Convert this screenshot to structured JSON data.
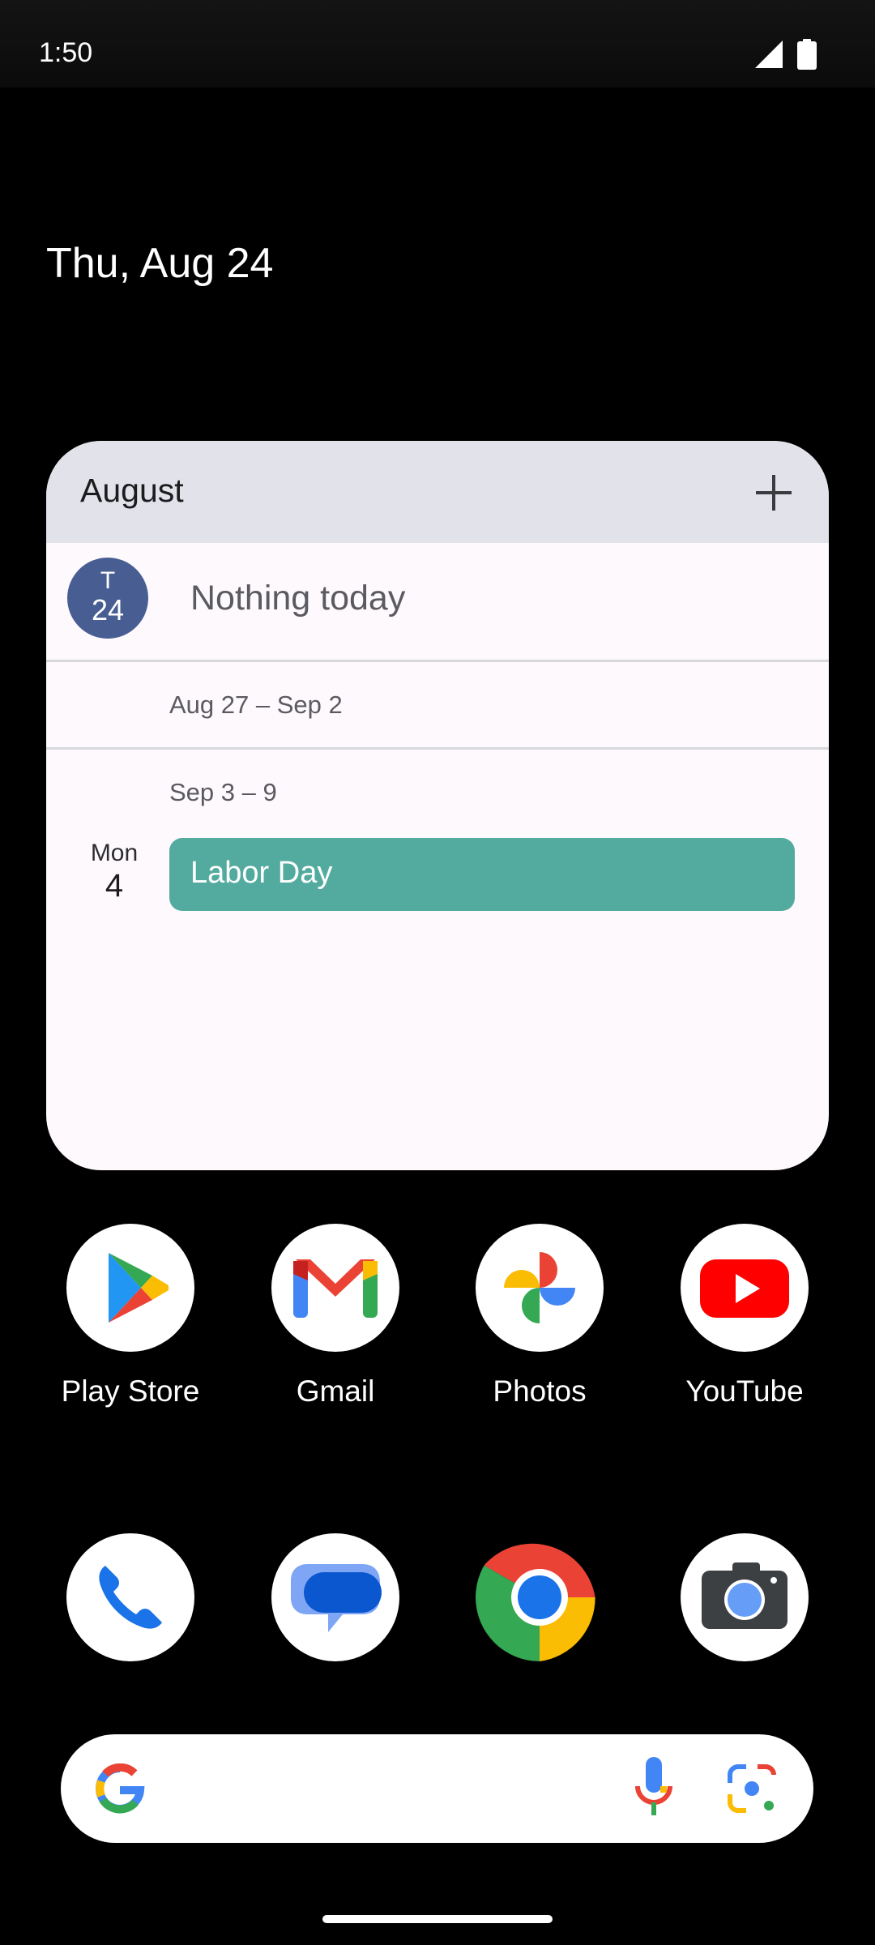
{
  "status_bar": {
    "time": "1:50"
  },
  "home": {
    "date": "Thu, Aug 24"
  },
  "calendar_widget": {
    "month": "August",
    "today": {
      "day_letter": "T",
      "day_number": "24",
      "message": "Nothing today"
    },
    "weeks": [
      {
        "range": "Aug 27 – Sep 2"
      },
      {
        "range": "Sep 3 – 9"
      }
    ],
    "events": [
      {
        "day_of_week": "Mon",
        "day_of_month": "4",
        "title": "Labor Day",
        "color": "#53ab9f"
      }
    ]
  },
  "apps": [
    {
      "label": "Play Store",
      "icon": "play-store-icon"
    },
    {
      "label": "Gmail",
      "icon": "gmail-icon"
    },
    {
      "label": "Photos",
      "icon": "photos-icon"
    },
    {
      "label": "YouTube",
      "icon": "youtube-icon"
    }
  ],
  "dock": [
    {
      "icon": "phone-icon"
    },
    {
      "icon": "messages-icon"
    },
    {
      "icon": "chrome-icon"
    },
    {
      "icon": "camera-icon"
    }
  ],
  "search_bar": {
    "icons": [
      "google-icon",
      "microphone-icon",
      "lens-icon"
    ]
  }
}
